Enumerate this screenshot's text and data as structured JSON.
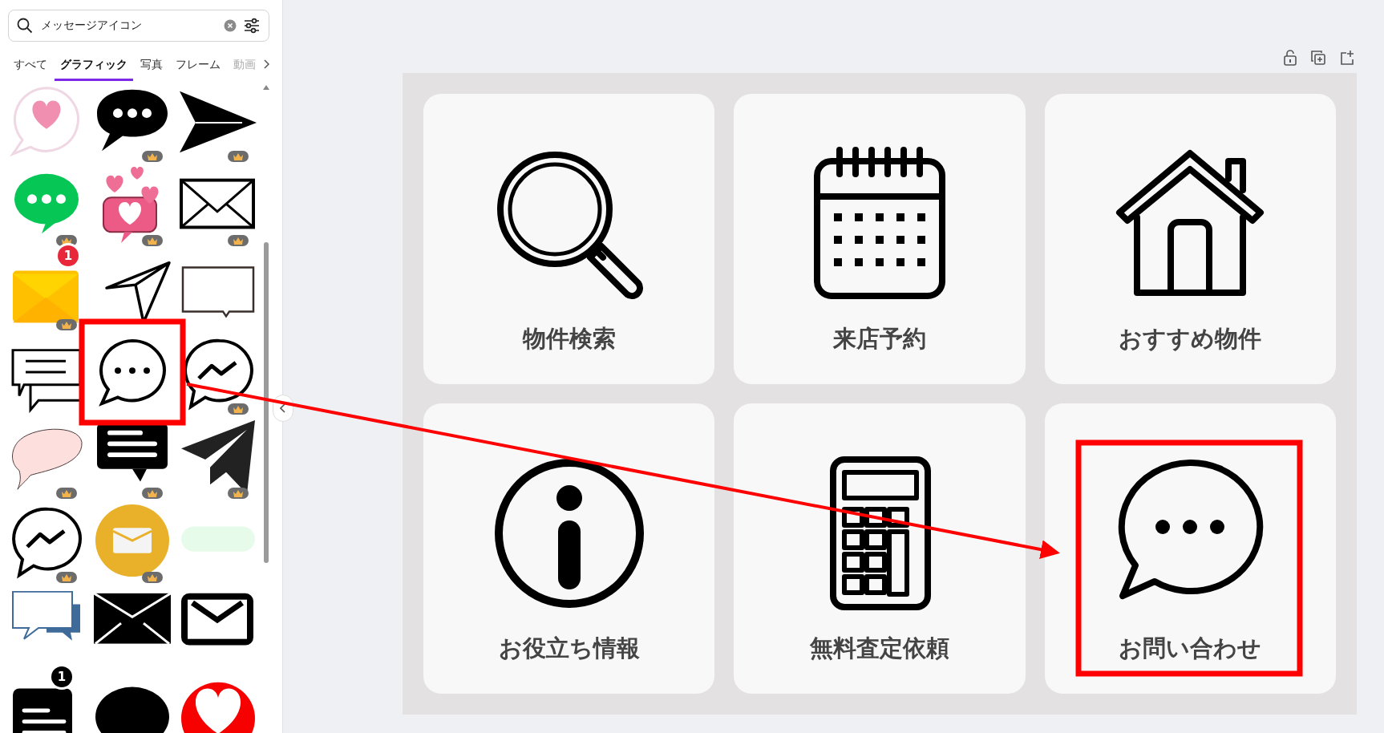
{
  "search": {
    "value": "メッセージアイコン"
  },
  "tabs": [
    {
      "label": "すべて",
      "selected": false
    },
    {
      "label": "グラフィック",
      "selected": true
    },
    {
      "label": "写真",
      "selected": false
    },
    {
      "label": "フレーム",
      "selected": false
    },
    {
      "label": "動画",
      "selected": false,
      "faded": true
    }
  ],
  "graphics": [
    {
      "kind": "heart-bubble",
      "premium": false
    },
    {
      "kind": "chat-dots-black",
      "premium": true
    },
    {
      "kind": "send-arrow",
      "premium": true
    },
    {
      "kind": "chat-dots-green",
      "premium": true
    },
    {
      "kind": "heart-notification",
      "premium": true
    },
    {
      "kind": "envelope-outline",
      "premium": true
    },
    {
      "kind": "envelope-yellow",
      "premium": true,
      "badge": "1"
    },
    {
      "kind": "paper-plane-outline",
      "premium": false
    },
    {
      "kind": "speech-rect",
      "premium": false
    },
    {
      "kind": "chat-lines",
      "premium": false
    },
    {
      "kind": "chat-dots-outline",
      "premium": false
    },
    {
      "kind": "messenger-outline",
      "premium": true
    },
    {
      "kind": "bubble-pink",
      "premium": true
    },
    {
      "kind": "chat-lines-black",
      "premium": true
    },
    {
      "kind": "paper-plane-black",
      "premium": true
    },
    {
      "kind": "messenger-outline",
      "premium": true
    },
    {
      "kind": "envelope-circle",
      "premium": true
    },
    {
      "kind": "bubble-mint",
      "premium": false
    },
    {
      "kind": "bubbles-blue",
      "premium": false
    },
    {
      "kind": "envelope-black",
      "premium": false
    },
    {
      "kind": "envelope-rounded",
      "premium": false
    },
    {
      "kind": "message-badge",
      "premium": false,
      "badge": "1"
    },
    {
      "kind": "oval-black",
      "premium": false
    },
    {
      "kind": "heart-circle",
      "premium": false
    }
  ],
  "cards": [
    {
      "kind": "search",
      "label": "物件検索"
    },
    {
      "kind": "calendar",
      "label": "来店予約"
    },
    {
      "kind": "house",
      "label": "おすすめ物件"
    },
    {
      "kind": "info",
      "label": "お役立ち情報"
    },
    {
      "kind": "calculator",
      "label": "無料査定依頼"
    },
    {
      "kind": "chat",
      "label": "お問い合わせ"
    }
  ]
}
